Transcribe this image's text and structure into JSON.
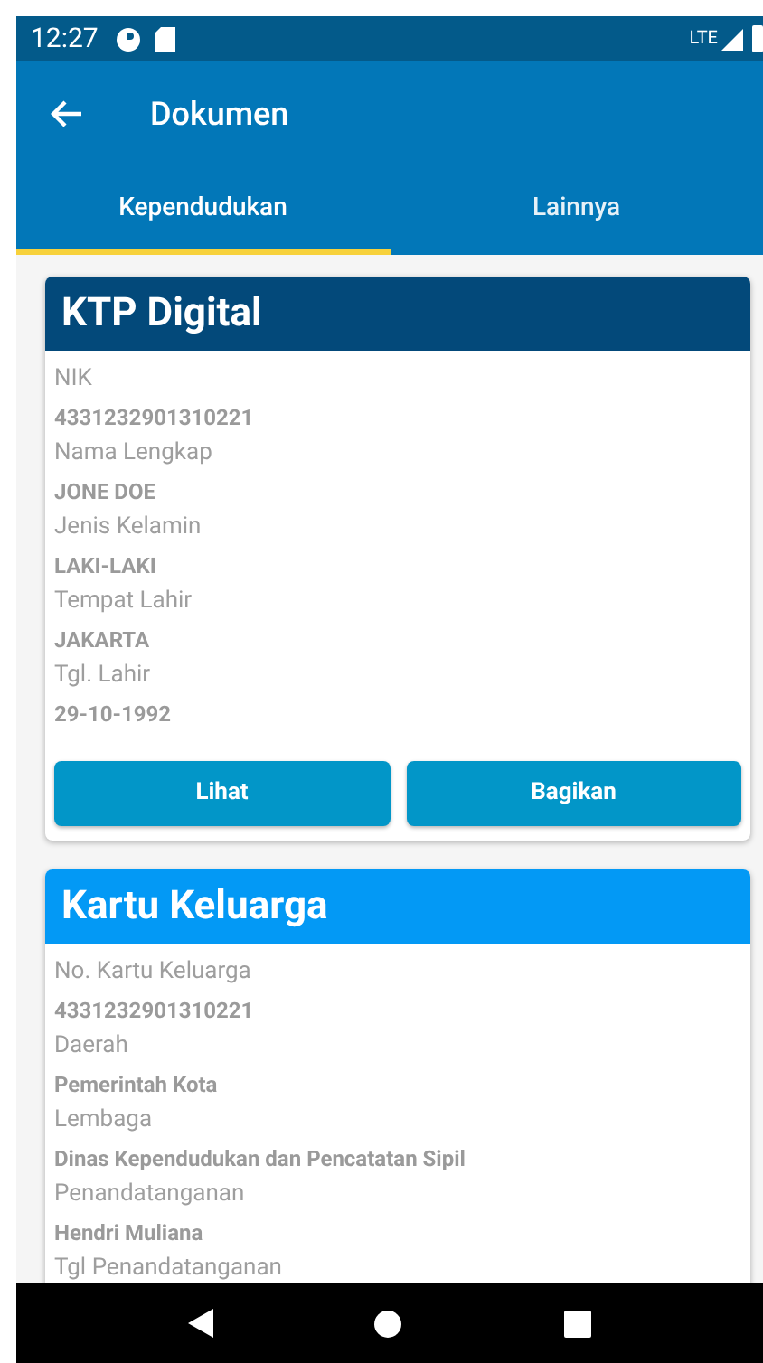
{
  "status_bar": {
    "time": "12:27",
    "network": "LTE"
  },
  "app_bar": {
    "title": "Dokumen"
  },
  "tabs": [
    {
      "label": "Kependudukan",
      "selected": true
    },
    {
      "label": "Lainnya",
      "selected": false
    }
  ],
  "cards": [
    {
      "title": "KTP Digital",
      "color": "#03497a",
      "fields": [
        {
          "label": "NIK",
          "value": "4331232901310221"
        },
        {
          "label": "Nama Lengkap",
          "value": "JONE DOE"
        },
        {
          "label": "Jenis Kelamin",
          "value": "LAKI-LAKI"
        },
        {
          "label": "Tempat Lahir",
          "value": "JAKARTA"
        },
        {
          "label": "Tgl. Lahir",
          "value": "29-10-1992"
        }
      ],
      "buttons": [
        "Lihat",
        "Bagikan"
      ]
    },
    {
      "title": "Kartu Keluarga",
      "color": "#0399f5",
      "fields": [
        {
          "label": "No. Kartu Keluarga",
          "value": "4331232901310221"
        },
        {
          "label": "Daerah",
          "value": "Pemerintah Kota"
        },
        {
          "label": "Lembaga",
          "value": "Dinas Kependudukan dan Pencatatan Sipil"
        },
        {
          "label": "Penandatanganan",
          "value": "Hendri Muliana"
        },
        {
          "label": "Tgl Penandatanganan"
        }
      ]
    }
  ]
}
